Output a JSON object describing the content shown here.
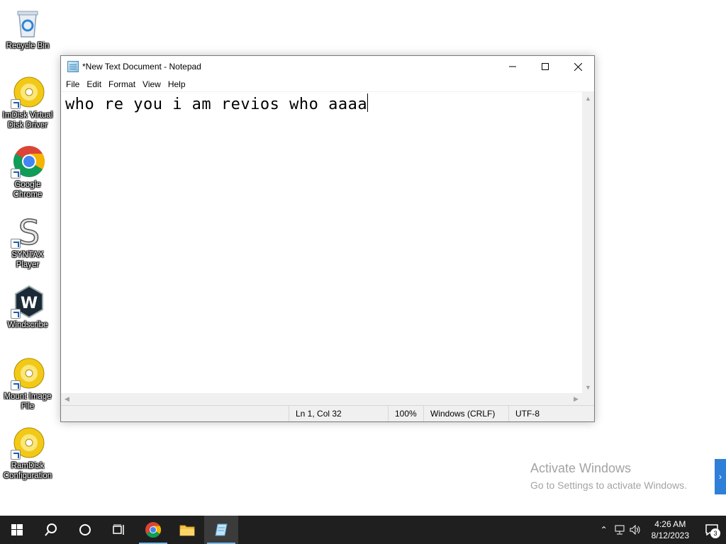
{
  "desktop": {
    "icons": [
      {
        "label": "Recycle Bin"
      },
      {
        "label": "ImDisk Virtual Disk Driver"
      },
      {
        "label": "Google Chrome"
      },
      {
        "label": "SYNTAX Player"
      },
      {
        "label": "Windscribe"
      },
      {
        "label": "Mount Image File"
      },
      {
        "label": "RamDisk Configuration"
      }
    ]
  },
  "notepad": {
    "title": "*New Text Document - Notepad",
    "menu": [
      "File",
      "Edit",
      "Format",
      "View",
      "Help"
    ],
    "content": "who re you i am revios who aaaa",
    "status": {
      "position": "Ln 1, Col 32",
      "zoom": "100%",
      "line_ending": "Windows (CRLF)",
      "encoding": "UTF-8"
    }
  },
  "watermark": {
    "line1": "Activate Windows",
    "line2": "Go to Settings to activate Windows."
  },
  "taskbar": {
    "clock_time": "4:26 AM",
    "clock_date": "8/12/2023",
    "notification_count": "3"
  },
  "colors": {
    "taskbar_bg": "#1f1f1f",
    "accent": "#76b9ed",
    "watermark": "#a3a3a3"
  }
}
